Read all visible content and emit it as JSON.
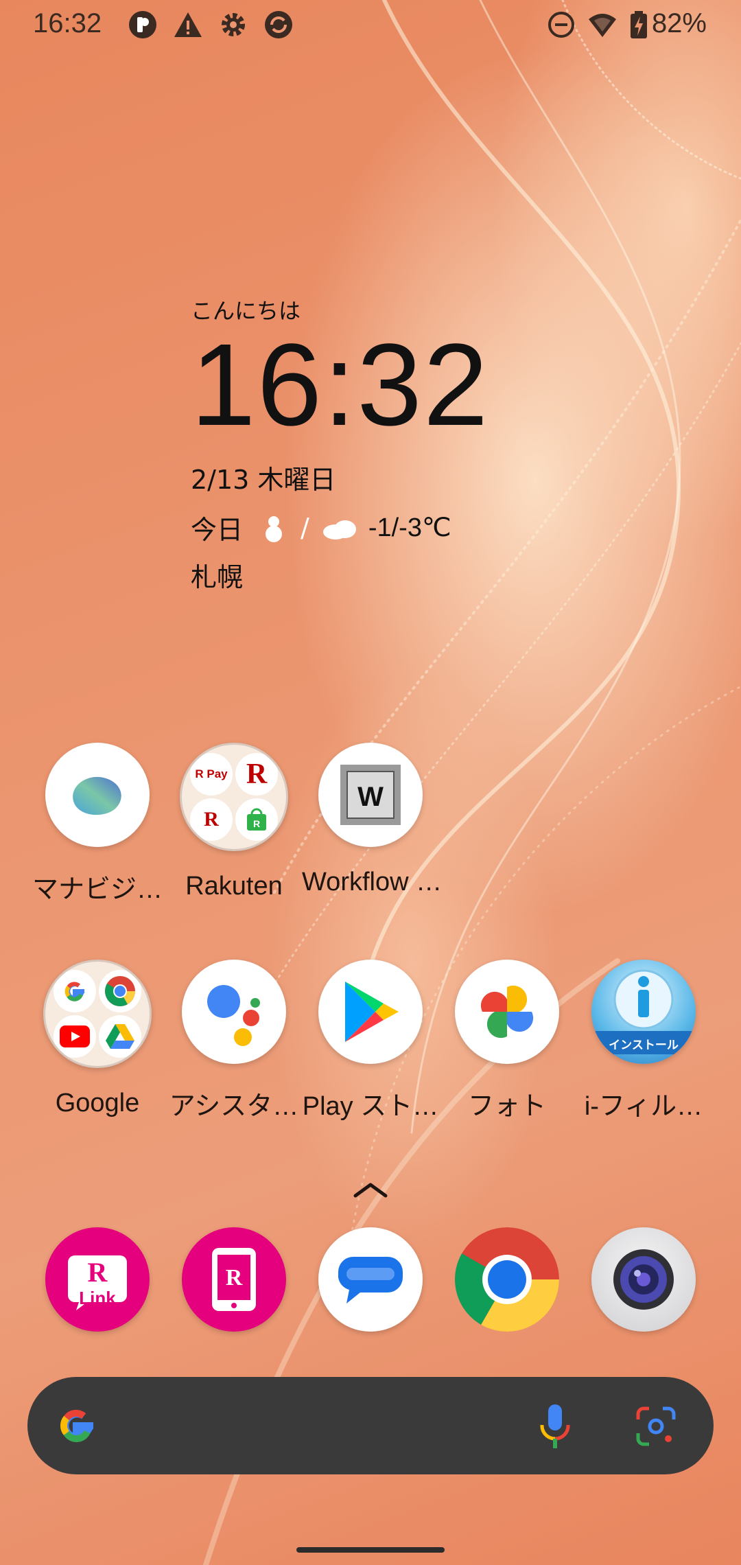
{
  "status_bar": {
    "time": "16:32",
    "battery": "82%",
    "icons": [
      "rakuten-notification-icon",
      "warning-icon",
      "settings-gear-icon",
      "sync-app-icon",
      "do-not-disturb-icon",
      "wifi-icon",
      "battery-charging-icon"
    ]
  },
  "widget": {
    "greeting": "こんにちは",
    "clock": "16:32",
    "date": "2/13 木曜日",
    "weather_label": "今日",
    "weather_icons": [
      "snowman-icon",
      "cloud-icon"
    ],
    "slash": "/",
    "temperature": "-1/-3℃",
    "city": "札幌"
  },
  "apps_row1": [
    {
      "label": "マナビジ…",
      "icon": "manabiji-blob-icon"
    },
    {
      "label": "Rakuten",
      "icon": "rakuten-folder-icon"
    },
    {
      "label": "Workflow …",
      "icon": "workflow-w-key-icon"
    }
  ],
  "apps_row2": [
    {
      "label": "Google",
      "icon": "google-folder-icon"
    },
    {
      "label": "アシスタ…",
      "icon": "google-assistant-icon"
    },
    {
      "label": "Play スト…",
      "icon": "play-store-icon"
    },
    {
      "label": "フォト",
      "icon": "google-photos-icon"
    },
    {
      "label": "i-フィル…",
      "icon": "i-filter-install-icon"
    }
  ],
  "i_filter_badge": "インストール",
  "rakuten_folder": {
    "pay_label": "R Pay"
  },
  "rakuten_link_label": "Link",
  "dock": [
    {
      "icon": "rakuten-link-icon"
    },
    {
      "icon": "rakuten-mobile-icon"
    },
    {
      "icon": "messages-icon"
    },
    {
      "icon": "chrome-icon"
    },
    {
      "icon": "camera-icon"
    }
  ],
  "search_bar": {
    "icons": [
      "google-g-icon",
      "microphone-icon",
      "google-lens-icon"
    ]
  },
  "colors": {
    "rakuten_pink": "#e5007d",
    "search_bg": "#3a3a3a",
    "google_blue": "#4285f4",
    "google_red": "#ea4335",
    "google_yellow": "#fbbc05",
    "google_green": "#34a853"
  }
}
